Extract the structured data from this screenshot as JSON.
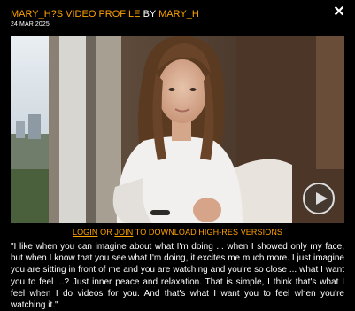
{
  "header": {
    "title_user": "MARY_H?S VIDEO PROFILE",
    "title_by": "BY",
    "title_author": "MARY_H",
    "date": "24 MAR 2025"
  },
  "close_icon": "close-icon",
  "video": {
    "thumbnail": "woman-in-white-tshirt-by-window",
    "play_icon": "play-icon"
  },
  "download": {
    "login": "LOGIN",
    "or": "OR",
    "join": "JOIN",
    "rest": "TO DOWNLOAD HIGH-RES VERSIONS"
  },
  "quote": "\"I like when you can imagine about what I'm doing ... when I showed only my face, but when I know that you see what I'm doing, it excites me much more. I just imagine you are sitting in front of me and you are watching and you're so close ... what I want you to feel ...? Just inner peace and relaxation. That is simple, I think that's what I feel when I do videos for you. And that's what I want you to feel when you're watching it.\"",
  "colors": {
    "accent": "#ffa100",
    "background": "#000000",
    "text": "#ffffff"
  }
}
